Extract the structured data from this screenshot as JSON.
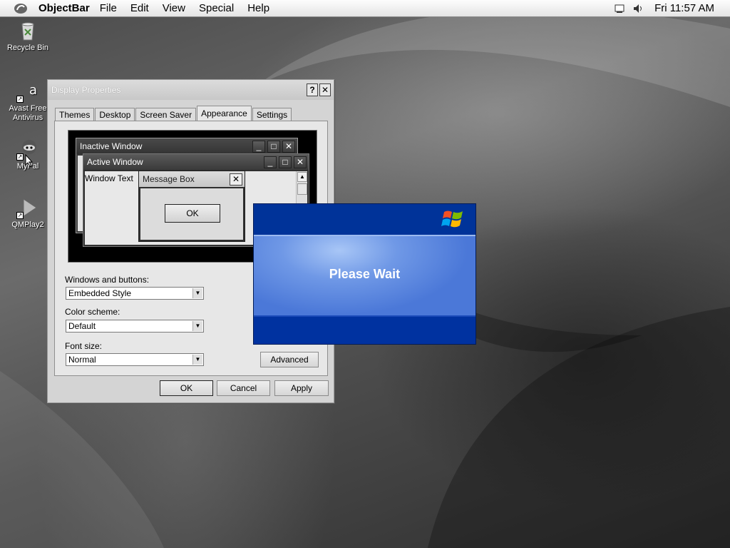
{
  "menubar": {
    "app_name": "ObjectBar",
    "items": [
      "File",
      "Edit",
      "View",
      "Special",
      "Help"
    ],
    "clock": "Fri 11:57 AM"
  },
  "desktop_icons": [
    {
      "label": "Recycle Bin",
      "icon": "recycle-bin-icon"
    },
    {
      "label": "Avast Free Antivirus",
      "icon": "avast-icon"
    },
    {
      "label": "MyPal",
      "icon": "mypal-icon"
    },
    {
      "label": "QMPlay2",
      "icon": "qmplay2-icon"
    }
  ],
  "display_properties": {
    "title": "Display Properties",
    "help_button": "?",
    "close_button": "✕",
    "tabs": [
      "Themes",
      "Desktop",
      "Screen Saver",
      "Appearance",
      "Settings"
    ],
    "active_tab": "Appearance",
    "preview": {
      "inactive_window": "Inactive Window",
      "active_window": "Active Window",
      "window_text": "Window Text",
      "message_box": "Message Box",
      "ok": "OK"
    },
    "windows_and_buttons_label": "Windows and buttons:",
    "windows_and_buttons_value": "Embedded Style",
    "color_scheme_label": "Color scheme:",
    "color_scheme_value": "Default",
    "font_size_label": "Font size:",
    "font_size_value": "Normal",
    "advanced_button": "Advanced",
    "ok_button": "OK",
    "cancel_button": "Cancel",
    "apply_button": "Apply"
  },
  "please_wait": {
    "message": "Please Wait"
  },
  "colors": {
    "xp_blue": "#00309c",
    "dialog_gray": "#d4d4d4"
  }
}
